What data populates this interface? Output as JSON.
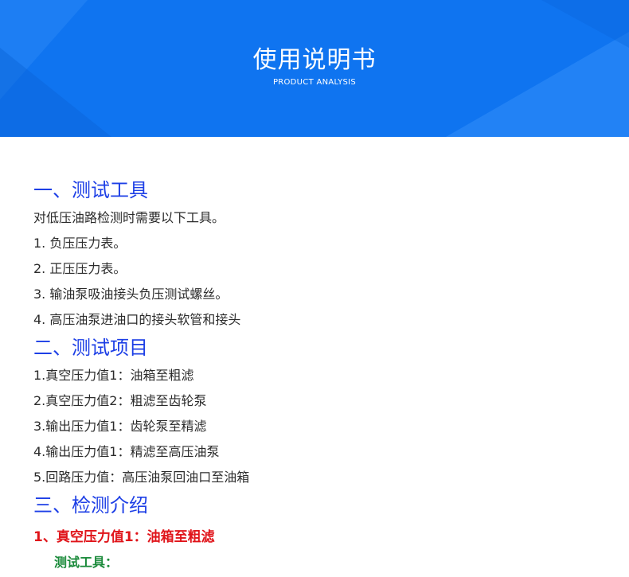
{
  "banner": {
    "title": "使用说明书",
    "subtitle": "PRODUCT ANALYSIS"
  },
  "sections": {
    "s1": {
      "heading": "一、测试工具",
      "lines": [
        "对低压油路检测时需要以下工具。",
        "1. 负压压力表。",
        "2. 正压压力表。",
        "3. 输油泵吸油接头负压测试螺丝。",
        "4. 高压油泵进油口的接头软管和接头"
      ]
    },
    "s2": {
      "heading": "二、测试项目",
      "lines": [
        "1.真空压力值1：油箱至粗滤",
        "2.真空压力值2：粗滤至齿轮泵",
        "3.输出压力值1：齿轮泵至精滤",
        "4.输出压力值1：精滤至高压油泵",
        "5.回路压力值：高压油泵回油口至油箱"
      ]
    },
    "s3": {
      "heading": "三、检测介绍",
      "sub_heading": "1、真空压力值1：油箱至粗滤",
      "tools_label": "测试工具："
    }
  },
  "colors": {
    "banner_blue": "#0f74f0",
    "section_heading": "#1d3fe6",
    "red_heading": "#e0141a",
    "green_label": "#1a8a3a"
  }
}
